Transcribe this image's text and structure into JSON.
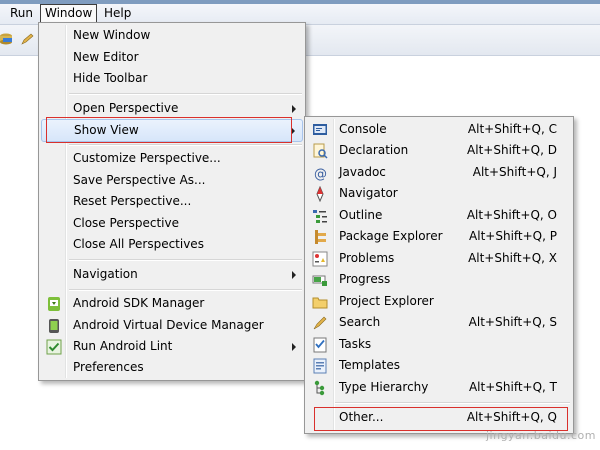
{
  "menubar": {
    "run": "Run",
    "window": "Window",
    "help": "Help"
  },
  "window_menu": {
    "new_window": "New Window",
    "new_editor": "New Editor",
    "hide_toolbar": "Hide Toolbar",
    "open_perspective": "Open Perspective",
    "show_view": "Show View",
    "customize_perspective": "Customize Perspective...",
    "save_perspective_as": "Save Perspective As...",
    "reset_perspective": "Reset Perspective...",
    "close_perspective": "Close Perspective",
    "close_all_perspectives": "Close All Perspectives",
    "navigation": "Navigation",
    "android_sdk_manager": "Android SDK Manager",
    "android_avd_manager": "Android Virtual Device Manager",
    "run_android_lint": "Run Android Lint",
    "preferences": "Preferences"
  },
  "show_view_menu": {
    "items": [
      {
        "label": "Console",
        "shortcut": "Alt+Shift+Q, C",
        "icon": "console-icon"
      },
      {
        "label": "Declaration",
        "shortcut": "Alt+Shift+Q, D",
        "icon": "declaration-icon"
      },
      {
        "label": "Javadoc",
        "shortcut": "Alt+Shift+Q, J",
        "icon": "javadoc-icon"
      },
      {
        "label": "Navigator",
        "shortcut": "",
        "icon": "navigator-icon"
      },
      {
        "label": "Outline",
        "shortcut": "Alt+Shift+Q, O",
        "icon": "outline-icon"
      },
      {
        "label": "Package Explorer",
        "shortcut": "Alt+Shift+Q, P",
        "icon": "package-explorer-icon"
      },
      {
        "label": "Problems",
        "shortcut": "Alt+Shift+Q, X",
        "icon": "problems-icon"
      },
      {
        "label": "Progress",
        "shortcut": "",
        "icon": "progress-icon"
      },
      {
        "label": "Project Explorer",
        "shortcut": "",
        "icon": "project-explorer-icon"
      },
      {
        "label": "Search",
        "shortcut": "Alt+Shift+Q, S",
        "icon": "search-icon"
      },
      {
        "label": "Tasks",
        "shortcut": "",
        "icon": "tasks-icon"
      },
      {
        "label": "Templates",
        "shortcut": "",
        "icon": "templates-icon"
      },
      {
        "label": "Type Hierarchy",
        "shortcut": "Alt+Shift+Q, T",
        "icon": "type-hierarchy-icon"
      }
    ],
    "other": {
      "label": "Other...",
      "shortcut": "Alt+Shift+Q, Q"
    }
  },
  "watermark": "jingyan.baidu.com",
  "colors": {
    "highlight_border": "#a8c5ec",
    "annotation_red": "#d9302c",
    "menu_bg": "#f0f0f0"
  }
}
